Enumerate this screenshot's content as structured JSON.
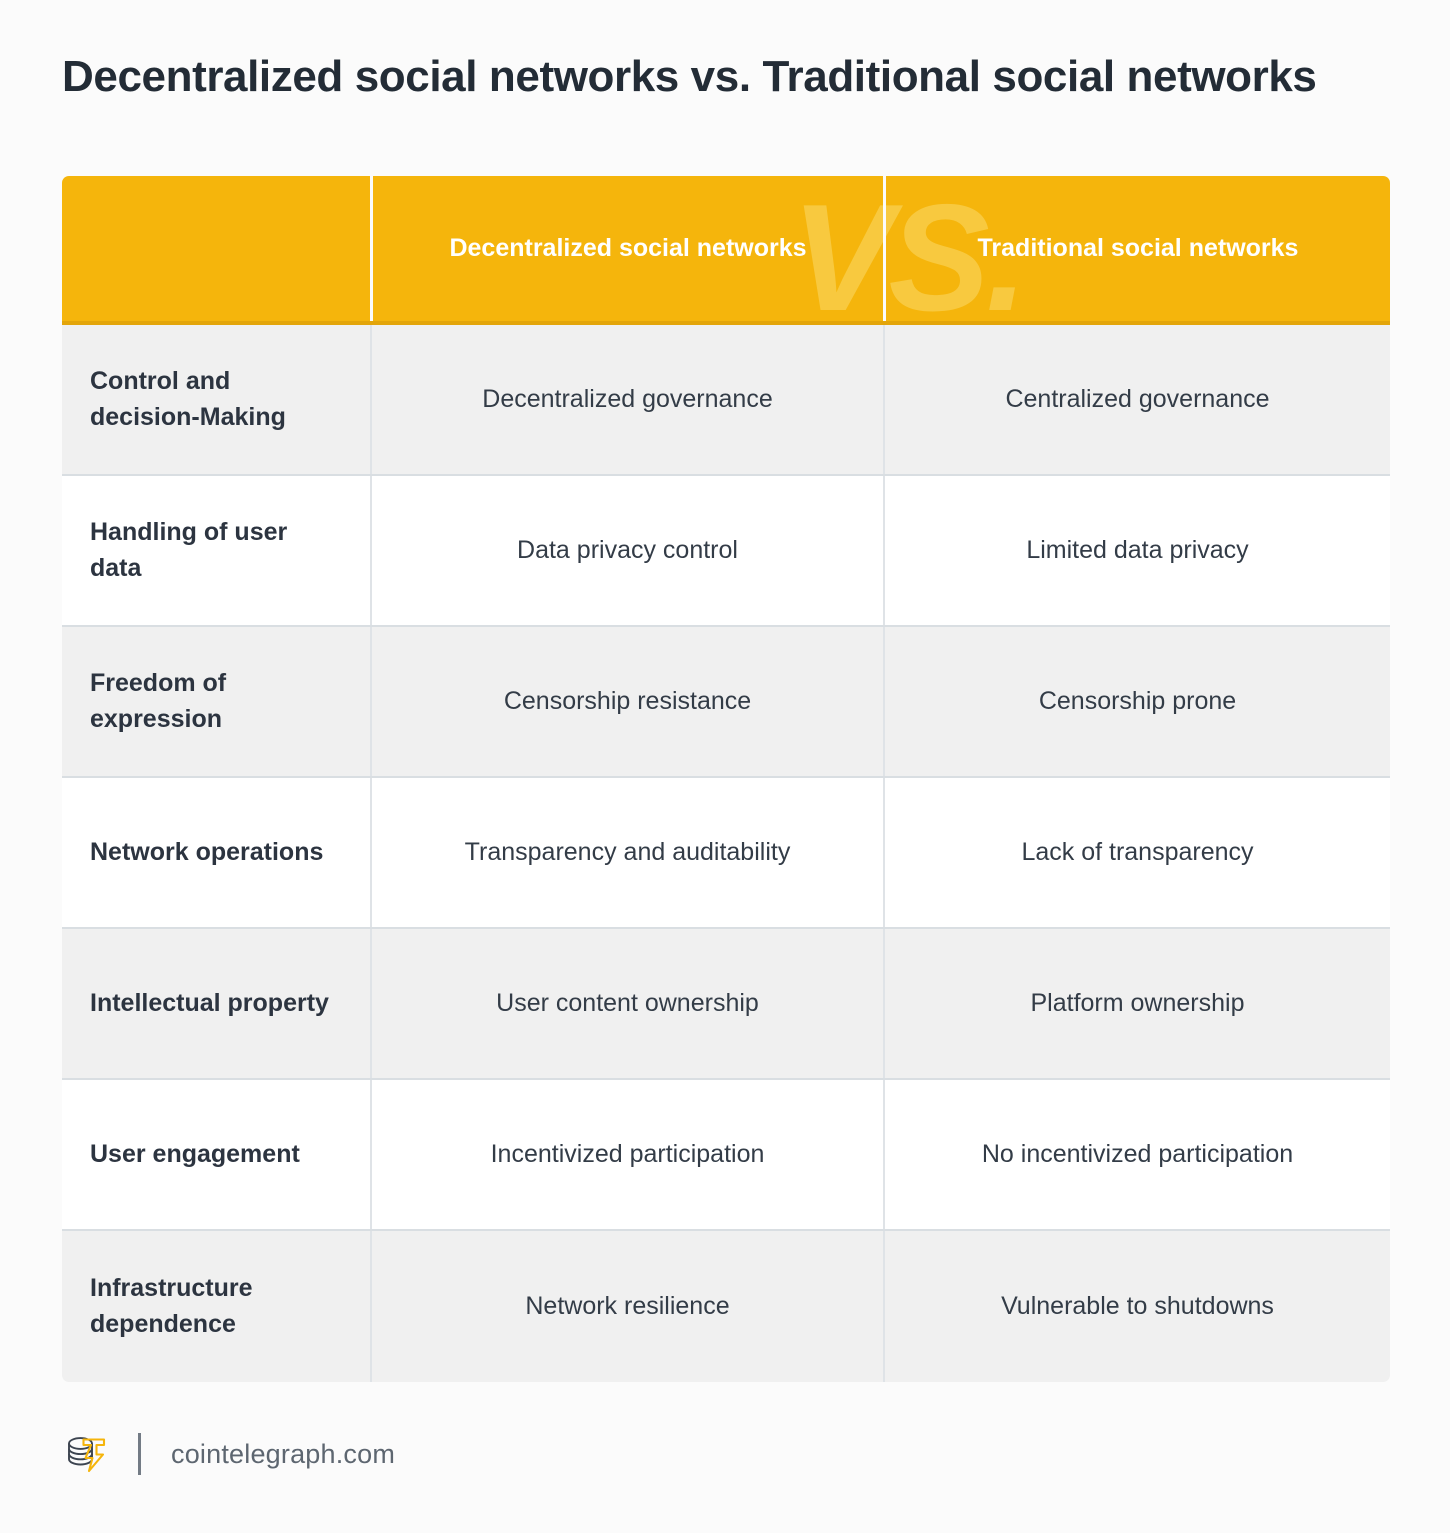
{
  "title": "Decentralized social networks vs. Traditional social networks",
  "watermark": "VS.",
  "colors": {
    "header_yellow": "#f5b50c",
    "header_border": "#e3a50a",
    "watermark_yellow": "#f8c93f",
    "row_shaded": "#f0f0f0",
    "row_plain": "#ffffff",
    "text_dark": "#2c3440",
    "page_background": "#fbfbfb",
    "logo_yellow": "#f5b50c",
    "logo_dark": "#3c4450"
  },
  "table": {
    "headers": {
      "corner": "",
      "col2": "Decentralized social networks",
      "col3": "Traditional social networks"
    },
    "rows": [
      {
        "label": "Control and decision-Making",
        "decentralized": "Decentralized governance",
        "traditional": "Centralized governance"
      },
      {
        "label": "Handling of user data",
        "decentralized": "Data privacy control",
        "traditional": "Limited data privacy"
      },
      {
        "label": "Freedom of expression",
        "decentralized": "Censorship resistance",
        "traditional": "Censorship prone"
      },
      {
        "label": "Network operations",
        "decentralized": "Transparency and auditability",
        "traditional": "Lack of transparency"
      },
      {
        "label": "Intellectual property",
        "decentralized": "User content ownership",
        "traditional": "Platform ownership"
      },
      {
        "label": "User engagement",
        "decentralized": "Incentivized participation",
        "traditional": "No incentivized participation"
      },
      {
        "label": "Infrastructure dependence",
        "decentralized": "Network resilience",
        "traditional": "Vulnerable to shutdowns"
      }
    ]
  },
  "footer": {
    "logo_icon": "cointelegraph-coin-stack-logo-icon",
    "site": "cointelegraph.com"
  }
}
